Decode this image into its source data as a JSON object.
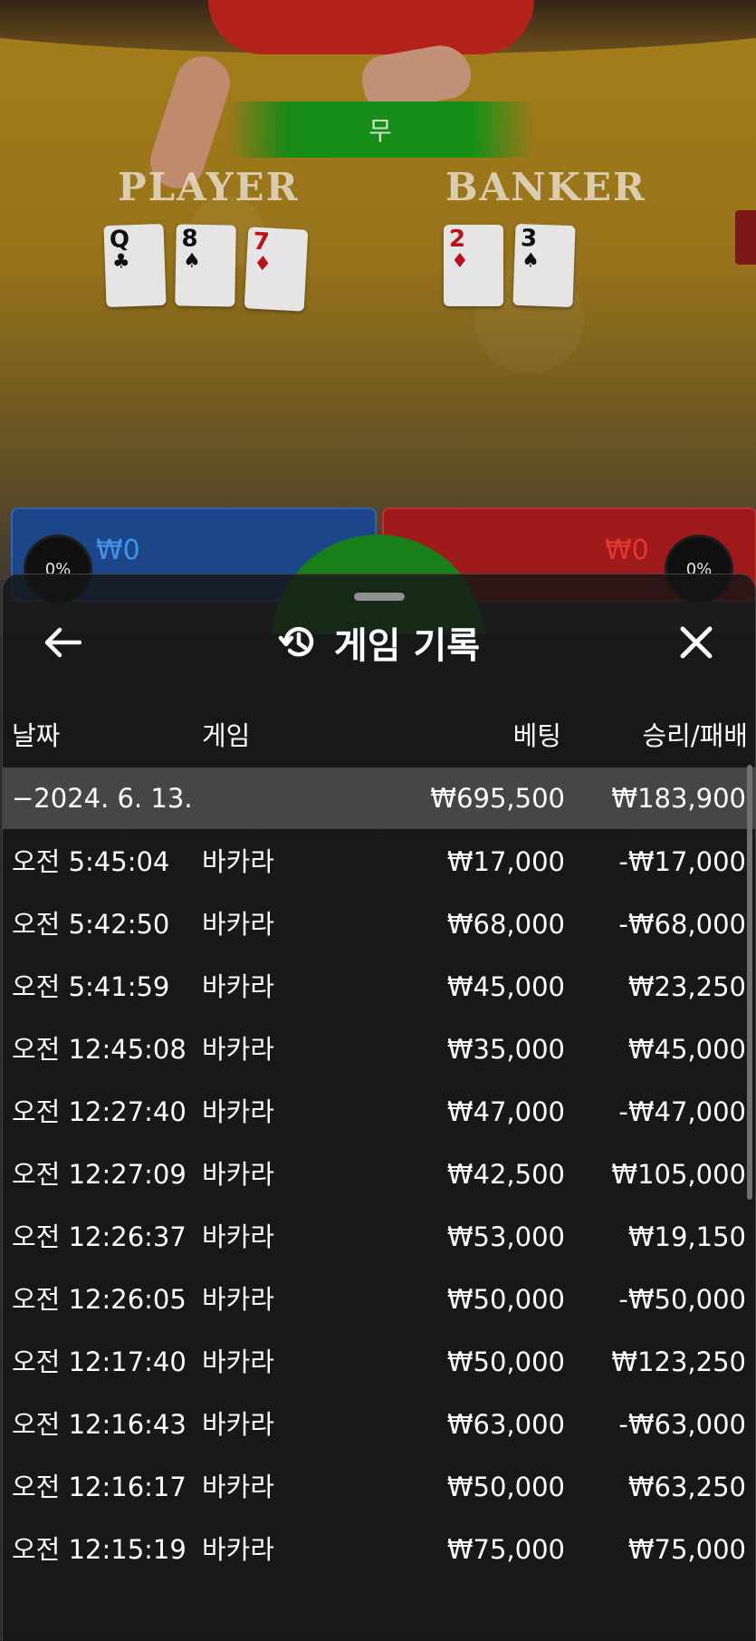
{
  "stream": {
    "result": "무",
    "player_label": "PLAYER",
    "banker_label": "BANKER",
    "player_cards": [
      {
        "rank": "Q",
        "suit": "♣",
        "color": "black"
      },
      {
        "rank": "8",
        "suit": "♠",
        "color": "black"
      },
      {
        "rank": "7",
        "suit": "♦",
        "color": "red"
      }
    ],
    "banker_cards": [
      {
        "rank": "2",
        "suit": "♦",
        "color": "red"
      },
      {
        "rank": "3",
        "suit": "♠",
        "color": "black"
      }
    ],
    "player_pct": "0%",
    "player_bet": "₩0",
    "banker_pct": "0%",
    "banker_bet": "₩0"
  },
  "sheet": {
    "title": "게임 기록",
    "back_icon": "arrow-left-icon",
    "history_icon": "history-icon",
    "close_icon": "close-icon",
    "columns": {
      "date": "날짜",
      "game": "게임",
      "bet": "베팅",
      "win_loss": "승리/패배"
    },
    "summary": {
      "date": "−2024. 6. 13.",
      "bet": "₩695,500",
      "win_loss": "₩183,900"
    },
    "rows": [
      {
        "time": "오전 5:45:04",
        "game": "바카라",
        "bet": "₩17,000",
        "win_loss": "-₩17,000"
      },
      {
        "time": "오전 5:42:50",
        "game": "바카라",
        "bet": "₩68,000",
        "win_loss": "-₩68,000"
      },
      {
        "time": "오전 5:41:59",
        "game": "바카라",
        "bet": "₩45,000",
        "win_loss": "₩23,250"
      },
      {
        "time": "오전 12:45:08",
        "game": "바카라",
        "bet": "₩35,000",
        "win_loss": "₩45,000"
      },
      {
        "time": "오전 12:27:40",
        "game": "바카라",
        "bet": "₩47,000",
        "win_loss": "-₩47,000"
      },
      {
        "time": "오전 12:27:09",
        "game": "바카라",
        "bet": "₩42,500",
        "win_loss": "₩105,000"
      },
      {
        "time": "오전 12:26:37",
        "game": "바카라",
        "bet": "₩53,000",
        "win_loss": "₩19,150"
      },
      {
        "time": "오전 12:26:05",
        "game": "바카라",
        "bet": "₩50,000",
        "win_loss": "-₩50,000"
      },
      {
        "time": "오전 12:17:40",
        "game": "바카라",
        "bet": "₩50,000",
        "win_loss": "₩123,250"
      },
      {
        "time": "오전 12:16:43",
        "game": "바카라",
        "bet": "₩63,000",
        "win_loss": "-₩63,000"
      },
      {
        "time": "오전 12:16:17",
        "game": "바카라",
        "bet": "₩50,000",
        "win_loss": "₩63,250"
      },
      {
        "time": "오전 12:15:19",
        "game": "바카라",
        "bet": "₩75,000",
        "win_loss": "₩75,000"
      }
    ]
  }
}
